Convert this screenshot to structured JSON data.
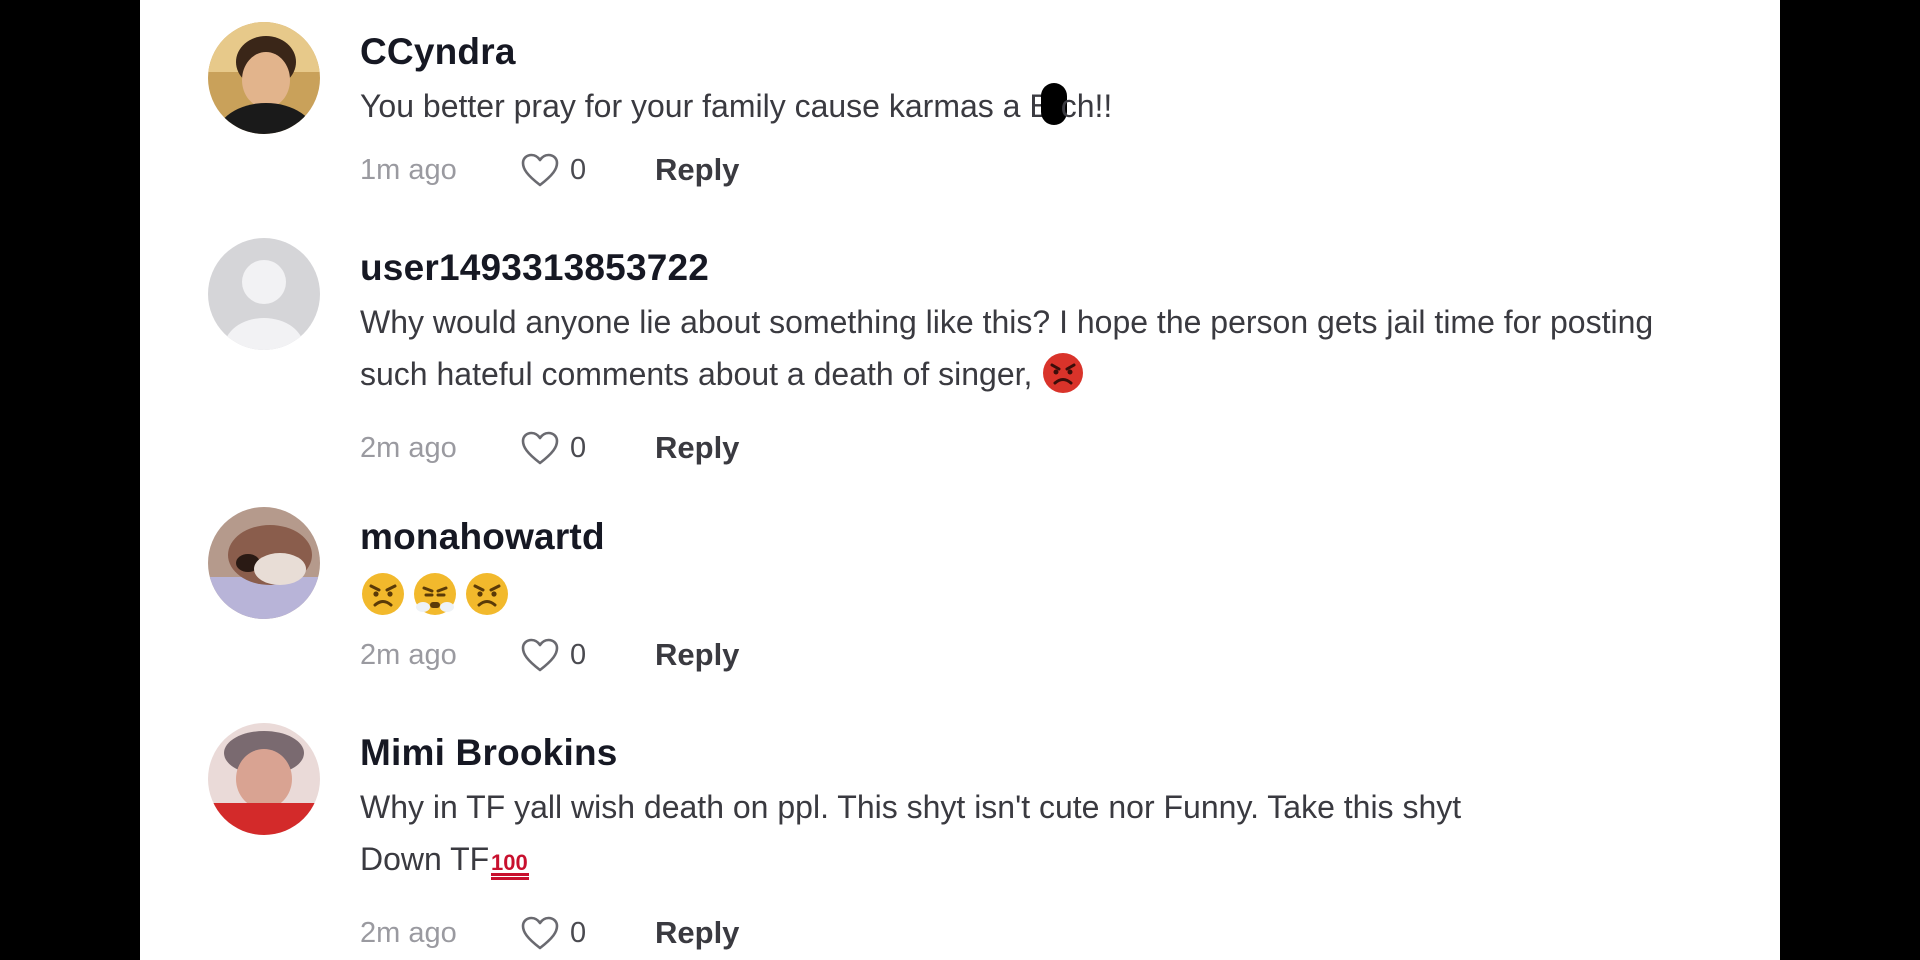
{
  "comments": [
    {
      "username": "CCyndra",
      "text_before": "You better pray for your family cause karmas a B",
      "text_after": "ch!!",
      "time": "1m ago",
      "likes": "0",
      "reply_label": "Reply",
      "avatar": "photo-woman-dark-hair"
    },
    {
      "username": "user1493313853722",
      "text": "Why would anyone lie about something like this? I hope the person gets jail time for posting such hateful comments about a death of singer,",
      "emoji": "angry-face-red",
      "time": "2m ago",
      "likes": "0",
      "reply_label": "Reply",
      "avatar": "default-user-icon"
    },
    {
      "username": "monahowartd",
      "emojis": [
        "angry-face",
        "steam-nose-face",
        "angry-face"
      ],
      "time": "2m ago",
      "likes": "0",
      "reply_label": "Reply",
      "avatar": "photo-closeup-face"
    },
    {
      "username": "Mimi Brookins",
      "text_line1": "Why in TF yall wish death on ppl. This shyt isn't cute nor Funny. Take this shyt",
      "text_line2": "Down TF",
      "emoji": "hundred-points",
      "time": "2m ago",
      "likes": "0",
      "reply_label": "Reply",
      "avatar": "photo-woman-red-top"
    }
  ],
  "colors": {
    "background": "#000000",
    "panel": "#ffffff",
    "username": "#161823",
    "text": "#3a3a40",
    "meta": "#9a9aa0"
  }
}
